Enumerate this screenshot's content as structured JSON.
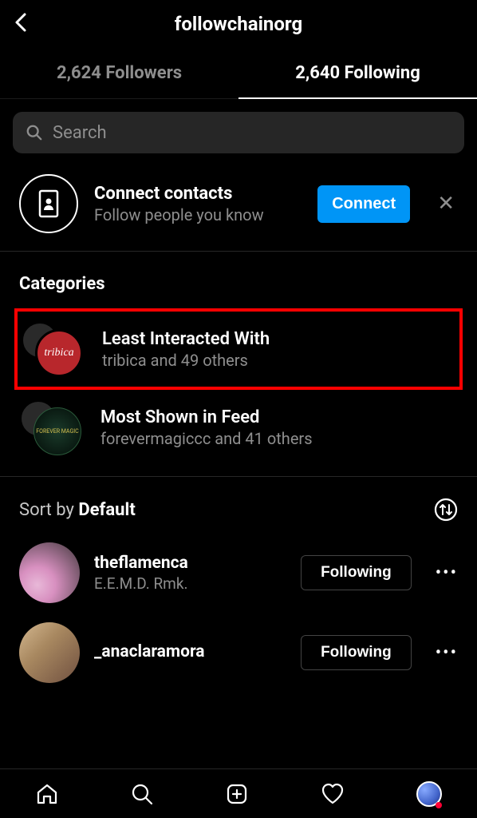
{
  "header": {
    "title": "followchainorg"
  },
  "tabs": {
    "followers": "2,624 Followers",
    "following": "2,640 Following"
  },
  "search": {
    "placeholder": "Search"
  },
  "connect": {
    "title": "Connect contacts",
    "subtitle": "Follow people you know",
    "button": "Connect"
  },
  "categories": {
    "heading": "Categories",
    "items": [
      {
        "title": "Least Interacted With",
        "subtitle": "tribica and 49 others",
        "badge": "tribica"
      },
      {
        "title": "Most Shown in Feed",
        "subtitle": "forevermagiccc and 41 others",
        "badge": "FOREVER MAGIC"
      }
    ]
  },
  "sort": {
    "prefix": "Sort by ",
    "value": "Default"
  },
  "users": [
    {
      "username": "theflamenca",
      "display": "E.E.M.D. Rmk.",
      "button": "Following"
    },
    {
      "username": "_anaclaramora",
      "display": "",
      "button": "Following"
    }
  ]
}
